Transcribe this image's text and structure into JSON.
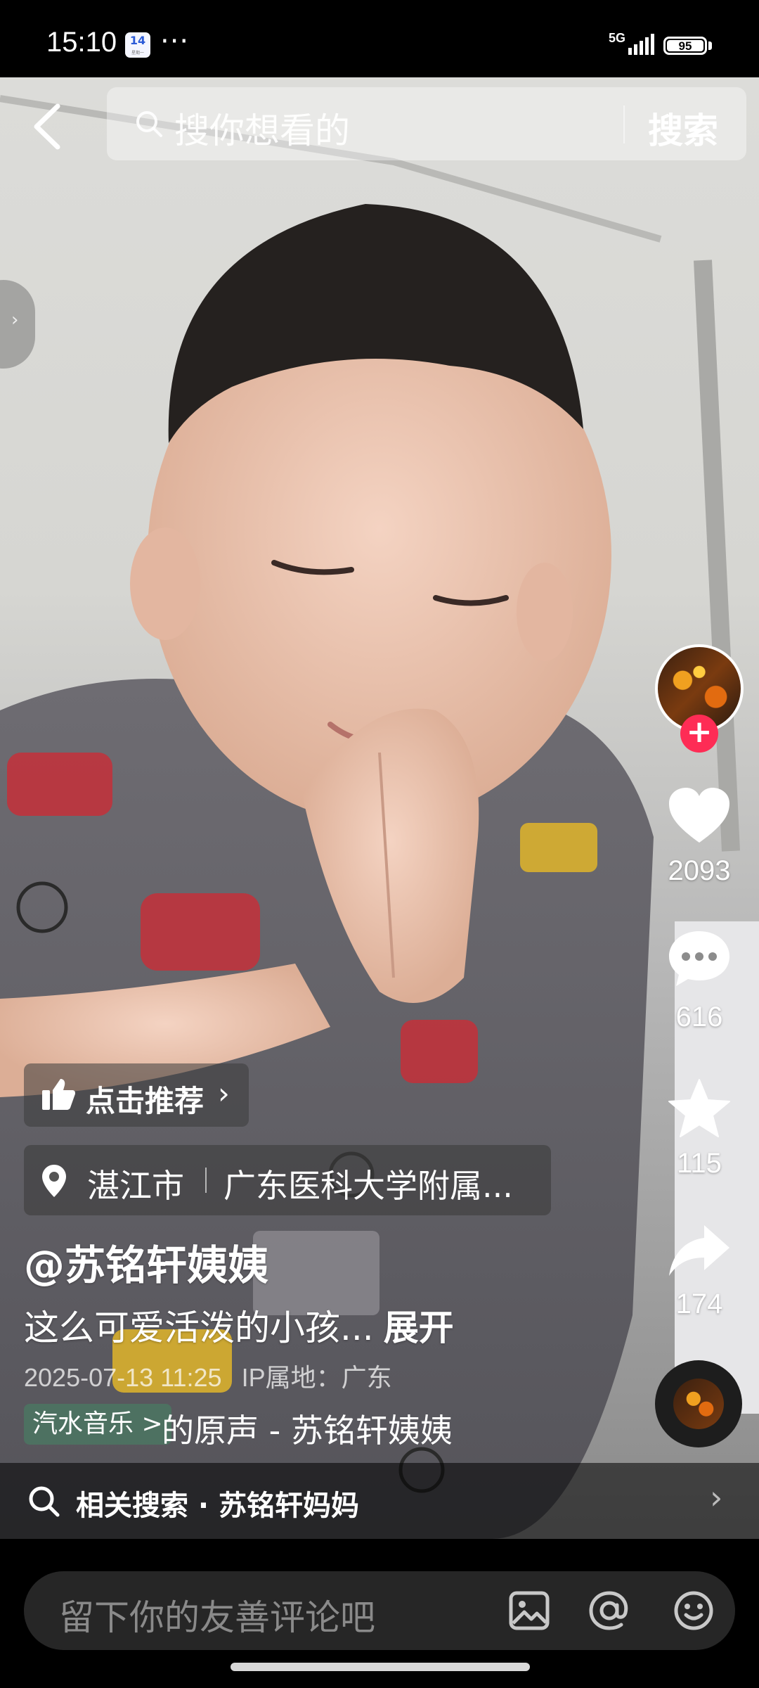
{
  "status_bar": {
    "time": "15:10",
    "calendar_day": "14",
    "calendar_sub": "星期一",
    "more": "···",
    "network": "5G",
    "battery": "95"
  },
  "search": {
    "placeholder": "搜你想看的",
    "button": "搜索"
  },
  "right_rail": {
    "likes": "2093",
    "comments": "616",
    "favorites": "115",
    "shares": "174"
  },
  "recommend": {
    "label": "点击推荐"
  },
  "location": {
    "city": "湛江市",
    "place": "广东医科大学附属..."
  },
  "post": {
    "author": "@苏铭轩姨姨",
    "description": "这么可爱活泼的小孩...",
    "expand": "展开",
    "date": "2025-07-13 11:25",
    "ip": "IP属地：广东"
  },
  "music": {
    "badge": "汽水音乐 >",
    "title": "的原声 - 苏铭轩姨姨"
  },
  "related": {
    "text": "相关搜索 · 苏铭轩妈妈"
  },
  "comment": {
    "placeholder": "留下你的友善评论吧"
  },
  "colors": {
    "accent": "#fe2c55",
    "background": "#000000"
  }
}
